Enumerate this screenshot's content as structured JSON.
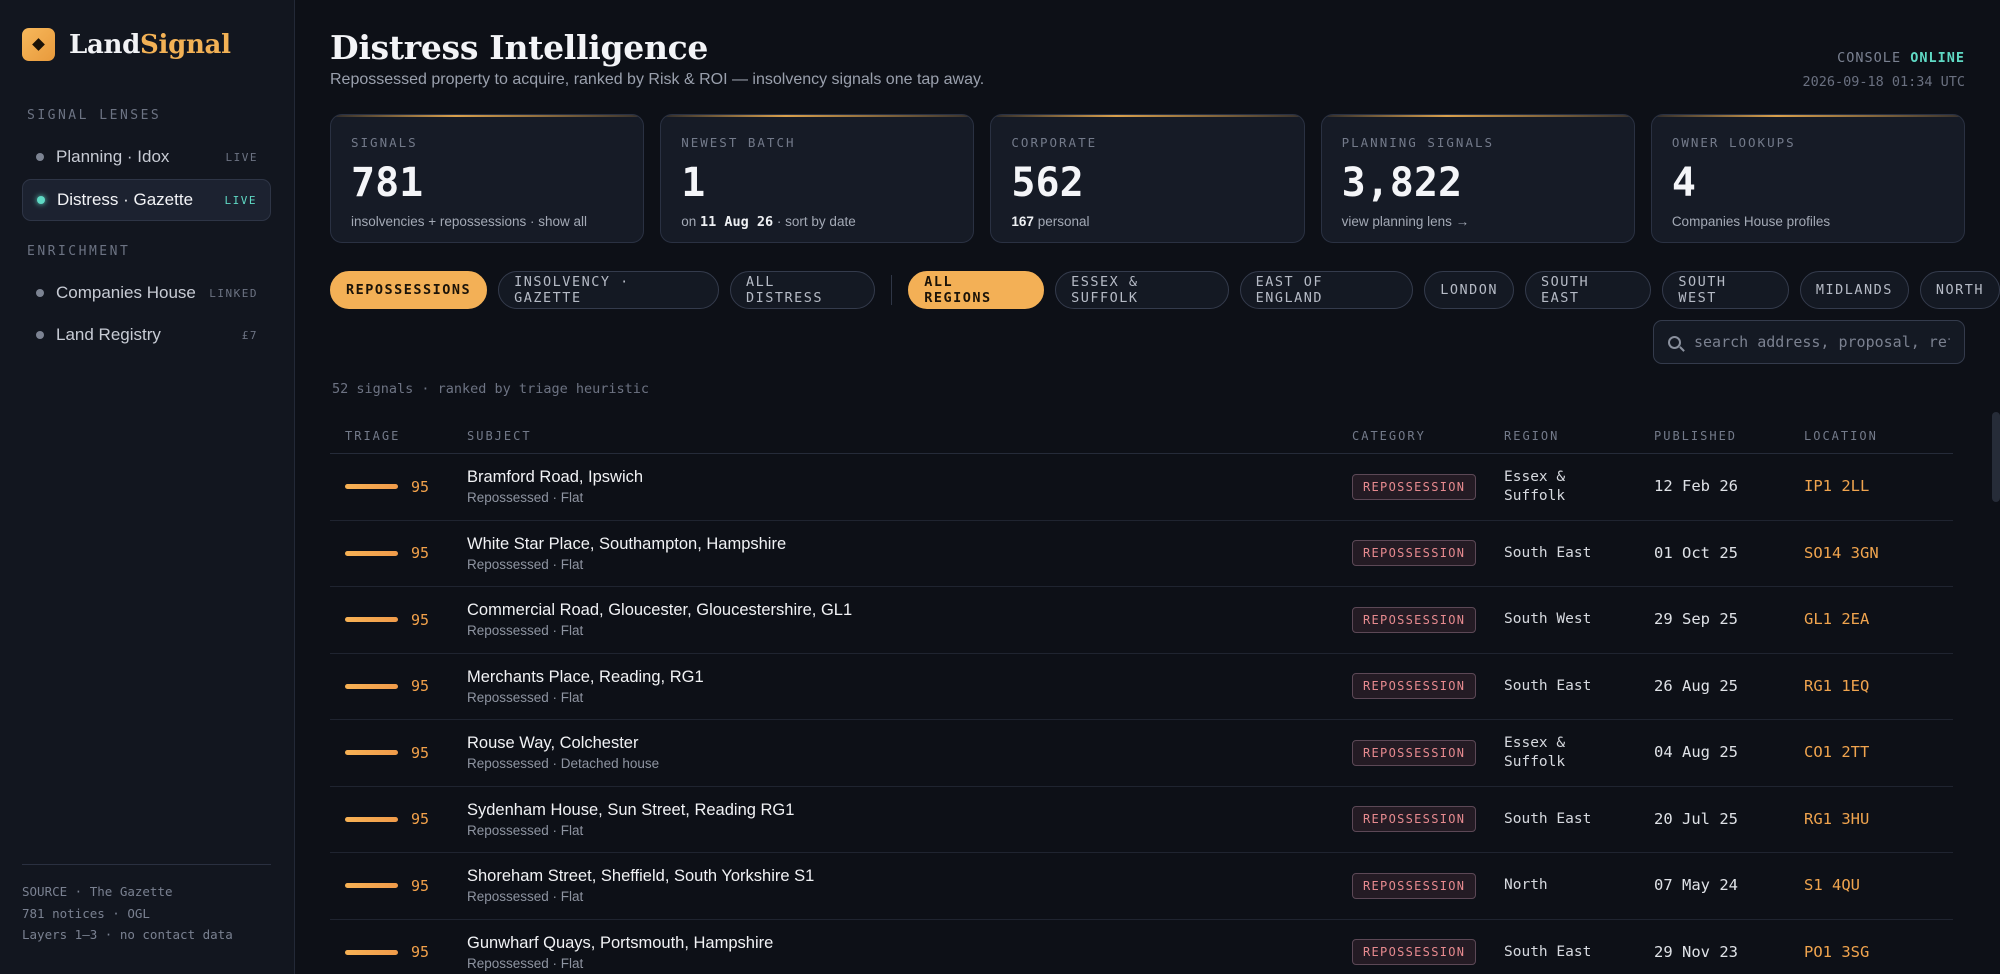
{
  "brand": {
    "word1": "Land",
    "word2": "Signal"
  },
  "sidebar": {
    "section_lenses": "SIGNAL LENSES",
    "lenses": [
      {
        "label": "Planning · Idox",
        "tag": "LIVE",
        "active": false
      },
      {
        "label": "Distress · Gazette",
        "tag": "LIVE",
        "active": true
      }
    ],
    "section_enrichment": "ENRICHMENT",
    "enrichment": [
      {
        "label": "Companies House",
        "tag": "LINKED"
      },
      {
        "label": "Land Registry",
        "tag": "£7"
      }
    ],
    "footer": [
      "SOURCE · The Gazette",
      "781 notices · OGL",
      "Layers 1–3 · no contact data"
    ]
  },
  "header": {
    "title": "Distress Intelligence",
    "subtitle": "Repossessed property to acquire, ranked by Risk & ROI — insolvency signals one tap away.",
    "console_label": "CONSOLE",
    "console_status": "ONLINE",
    "timestamp": "2026-09-18 01:34 UTC"
  },
  "kpis": [
    {
      "label": "SIGNALS",
      "value": "781",
      "note": "insolvencies + repossessions · show all"
    },
    {
      "label": "NEWEST BATCH",
      "value": "1",
      "note_prefix": "on",
      "note_bold": "11 Aug 26",
      "note_suffix": "· sort by date"
    },
    {
      "label": "CORPORATE",
      "value": "562",
      "note_bold": "167",
      "note_suffix": "personal"
    },
    {
      "label": "PLANNING SIGNALS",
      "value": "3,822",
      "note": "view planning lens →"
    },
    {
      "label": "OWNER LOOKUPS",
      "value": "4",
      "note": "Companies House profiles"
    }
  ],
  "filters": {
    "types": [
      {
        "label": "REPOSSESSIONS",
        "active": true
      },
      {
        "label": "INSOLVENCY · GAZETTE",
        "active": false
      },
      {
        "label": "ALL DISTRESS",
        "active": false
      }
    ],
    "regions": [
      {
        "label": "ALL REGIONS",
        "active": true
      },
      {
        "label": "ESSEX & SUFFOLK",
        "active": false
      },
      {
        "label": "EAST OF ENGLAND",
        "active": false
      },
      {
        "label": "LONDON",
        "active": false
      },
      {
        "label": "SOUTH EAST",
        "active": false
      },
      {
        "label": "SOUTH WEST",
        "active": false
      },
      {
        "label": "MIDLANDS",
        "active": false
      },
      {
        "label": "NORTH",
        "active": false
      }
    ]
  },
  "search": {
    "placeholder": "search address, proposal, ref",
    "value": ""
  },
  "summary": "52 signals · ranked by triage heuristic",
  "table": {
    "columns": [
      "TRIAGE",
      "SUBJECT",
      "CATEGORY",
      "REGION",
      "PUBLISHED",
      "LOCATION"
    ],
    "rows": [
      {
        "score": "95",
        "title": "Bramford Road, Ipswich",
        "meta": "Repossessed · Flat",
        "category": "REPOSSESSION",
        "region": "Essex & Suffolk",
        "published": "12 Feb 26",
        "location": "IP1 2LL"
      },
      {
        "score": "95",
        "title": "White Star Place, Southampton, Hampshire",
        "meta": "Repossessed · Flat",
        "category": "REPOSSESSION",
        "region": "South East",
        "published": "01 Oct 25",
        "location": "SO14 3GN"
      },
      {
        "score": "95",
        "title": "Commercial Road, Gloucester, Gloucestershire, GL1",
        "meta": "Repossessed · Flat",
        "category": "REPOSSESSION",
        "region": "South West",
        "published": "29 Sep 25",
        "location": "GL1 2EA"
      },
      {
        "score": "95",
        "title": "Merchants Place, Reading, RG1",
        "meta": "Repossessed · Flat",
        "category": "REPOSSESSION",
        "region": "South East",
        "published": "26 Aug 25",
        "location": "RG1 1EQ"
      },
      {
        "score": "95",
        "title": "Rouse Way, Colchester",
        "meta": "Repossessed · Detached house",
        "category": "REPOSSESSION",
        "region": "Essex & Suffolk",
        "published": "04 Aug 25",
        "location": "CO1 2TT"
      },
      {
        "score": "95",
        "title": "Sydenham House, Sun Street, Reading RG1",
        "meta": "Repossessed · Flat",
        "category": "REPOSSESSION",
        "region": "South East",
        "published": "20 Jul 25",
        "location": "RG1 3HU"
      },
      {
        "score": "95",
        "title": "Shoreham Street, Sheffield, South Yorkshire S1",
        "meta": "Repossessed · Flat",
        "category": "REPOSSESSION",
        "region": "North",
        "published": "07 May 24",
        "location": "S1 4QU"
      },
      {
        "score": "95",
        "title": "Gunwharf Quays, Portsmouth, Hampshire",
        "meta": "Repossessed · Flat",
        "category": "REPOSSESSION",
        "region": "South East",
        "published": "29 Nov 23",
        "location": "PO1 3SG"
      }
    ]
  },
  "colors": {
    "accent": "#f3b056",
    "live": "#5fd9c4",
    "badge_text": "#e78a8f",
    "background": "#0d1017"
  }
}
